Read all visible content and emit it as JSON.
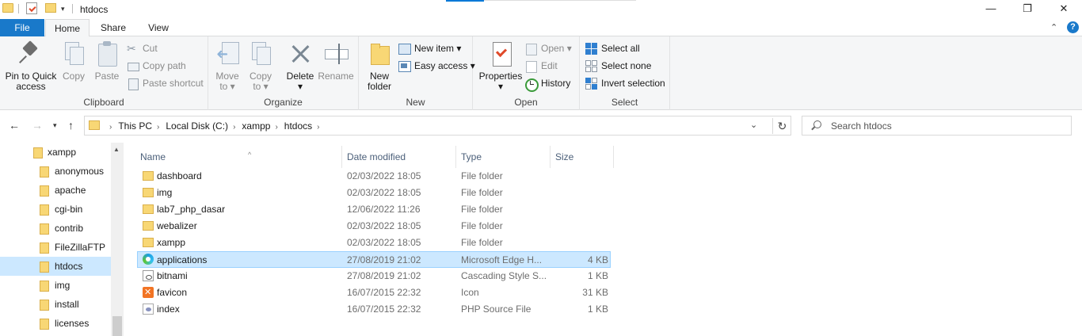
{
  "window": {
    "title": "htdocs",
    "quick_access_dropdown": "▾",
    "minimize": "—",
    "maximize": "❐",
    "close": "✕"
  },
  "ribbon_tabs": {
    "file": "File",
    "home": "Home",
    "share": "Share",
    "view": "View",
    "collapse": "⌃",
    "help": "?"
  },
  "ribbon": {
    "clipboard": {
      "label": "Clipboard",
      "pin_line1": "Pin to Quick",
      "pin_line2": "access",
      "copy": "Copy",
      "paste": "Paste",
      "cut": "Cut",
      "copy_path": "Copy path",
      "paste_shortcut": "Paste shortcut"
    },
    "organize": {
      "label": "Organize",
      "move_line1": "Move",
      "move_line2": "to ▾",
      "copy_line1": "Copy",
      "copy_line2": "to ▾",
      "delete_line1": "Delete",
      "delete_line2": "▾",
      "rename": "Rename"
    },
    "new": {
      "label": "New",
      "folder_line1": "New",
      "folder_line2": "folder",
      "new_item": "New item ▾",
      "easy_access": "Easy access ▾"
    },
    "open": {
      "label": "Open",
      "properties_line1": "Properties",
      "properties_line2": "▾",
      "open": "Open ▾",
      "edit": "Edit",
      "history": "History"
    },
    "select": {
      "label": "Select",
      "select_all": "Select all",
      "select_none": "Select none",
      "invert": "Invert selection"
    }
  },
  "nav": {
    "back": "←",
    "forward": "→",
    "recent": "▾",
    "up": "↑",
    "breadcrumb": [
      "This PC",
      "Local Disk (C:)",
      "xampp",
      "htdocs"
    ],
    "crumb_sep": "›",
    "address_dropdown": "⌄",
    "refresh": "↻",
    "search_placeholder": "Search htdocs"
  },
  "nav_pane": {
    "scroll_up": "▲",
    "items": [
      {
        "label": "xampp",
        "selected": false
      },
      {
        "label": "anonymous",
        "selected": false
      },
      {
        "label": "apache",
        "selected": false
      },
      {
        "label": "cgi-bin",
        "selected": false
      },
      {
        "label": "contrib",
        "selected": false
      },
      {
        "label": "FileZillaFTP",
        "selected": false
      },
      {
        "label": "htdocs",
        "selected": true
      },
      {
        "label": "img",
        "selected": false
      },
      {
        "label": "install",
        "selected": false
      },
      {
        "label": "licenses",
        "selected": false
      }
    ]
  },
  "columns": {
    "name": "Name",
    "date": "Date modified",
    "type": "Type",
    "size": "Size",
    "sort_indicator": "^"
  },
  "files": [
    {
      "name": "dashboard",
      "date": "02/03/2022 18:05",
      "type": "File folder",
      "size": "",
      "icon": "folder-icon",
      "selected": false
    },
    {
      "name": "img",
      "date": "02/03/2022 18:05",
      "type": "File folder",
      "size": "",
      "icon": "folder-icon",
      "selected": false
    },
    {
      "name": "lab7_php_dasar",
      "date": "12/06/2022 11:26",
      "type": "File folder",
      "size": "",
      "icon": "folder-icon",
      "selected": false
    },
    {
      "name": "webalizer",
      "date": "02/03/2022 18:05",
      "type": "File folder",
      "size": "",
      "icon": "folder-icon",
      "selected": false
    },
    {
      "name": "xampp",
      "date": "02/03/2022 18:05",
      "type": "File folder",
      "size": "",
      "icon": "folder-icon",
      "selected": false
    },
    {
      "name": "applications",
      "date": "27/08/2019 21:02",
      "type": "Microsoft Edge H...",
      "size": "4 KB",
      "icon": "edge-html-icon",
      "selected": true
    },
    {
      "name": "bitnami",
      "date": "27/08/2019 21:02",
      "type": "Cascading Style S...",
      "size": "1 KB",
      "icon": "css-file-icon",
      "selected": false
    },
    {
      "name": "favicon",
      "date": "16/07/2015 22:32",
      "type": "Icon",
      "size": "31 KB",
      "icon": "xampp-icon",
      "selected": false
    },
    {
      "name": "index",
      "date": "16/07/2015 22:32",
      "type": "PHP Source File",
      "size": "1 KB",
      "icon": "php-file-icon",
      "selected": false
    }
  ]
}
